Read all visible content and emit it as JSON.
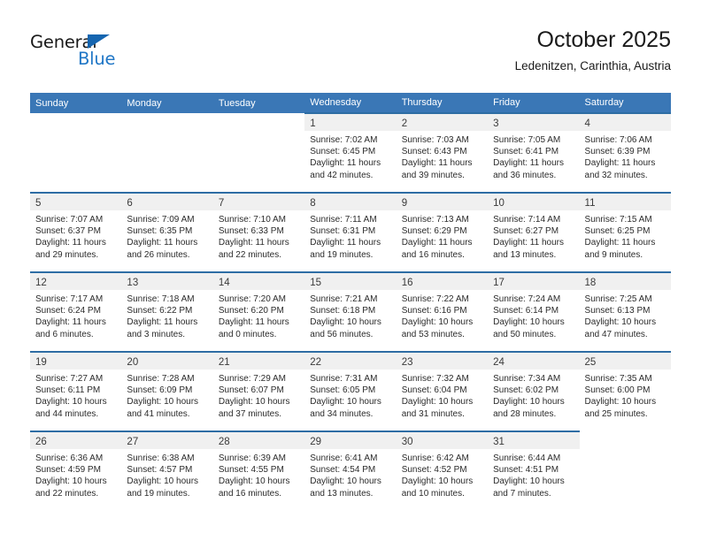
{
  "brand": {
    "name_part1": "General",
    "name_part2": "Blue"
  },
  "header": {
    "title": "October 2025",
    "subtitle": "Ledenitzen, Carinthia, Austria"
  },
  "colors": {
    "header_blue": "#3a77b6",
    "cell_border_blue": "#2e6da4",
    "daynum_band": "#f0f0f0",
    "brand_blue": "#1f76c6"
  },
  "weekdays": [
    "Sunday",
    "Monday",
    "Tuesday",
    "Wednesday",
    "Thursday",
    "Friday",
    "Saturday"
  ],
  "labels": {
    "sunrise_prefix": "Sunrise:",
    "sunset_prefix": "Sunset:",
    "daylight_prefix": "Daylight:"
  },
  "weeks": [
    [
      {
        "empty": true
      },
      {
        "empty": true
      },
      {
        "empty": true
      },
      {
        "day": "1",
        "sunrise": "Sunrise: 7:02 AM",
        "sunset": "Sunset: 6:45 PM",
        "daylight_line1": "Daylight: 11 hours",
        "daylight_line2": "and 42 minutes."
      },
      {
        "day": "2",
        "sunrise": "Sunrise: 7:03 AM",
        "sunset": "Sunset: 6:43 PM",
        "daylight_line1": "Daylight: 11 hours",
        "daylight_line2": "and 39 minutes."
      },
      {
        "day": "3",
        "sunrise": "Sunrise: 7:05 AM",
        "sunset": "Sunset: 6:41 PM",
        "daylight_line1": "Daylight: 11 hours",
        "daylight_line2": "and 36 minutes."
      },
      {
        "day": "4",
        "sunrise": "Sunrise: 7:06 AM",
        "sunset": "Sunset: 6:39 PM",
        "daylight_line1": "Daylight: 11 hours",
        "daylight_line2": "and 32 minutes."
      }
    ],
    [
      {
        "day": "5",
        "sunrise": "Sunrise: 7:07 AM",
        "sunset": "Sunset: 6:37 PM",
        "daylight_line1": "Daylight: 11 hours",
        "daylight_line2": "and 29 minutes."
      },
      {
        "day": "6",
        "sunrise": "Sunrise: 7:09 AM",
        "sunset": "Sunset: 6:35 PM",
        "daylight_line1": "Daylight: 11 hours",
        "daylight_line2": "and 26 minutes."
      },
      {
        "day": "7",
        "sunrise": "Sunrise: 7:10 AM",
        "sunset": "Sunset: 6:33 PM",
        "daylight_line1": "Daylight: 11 hours",
        "daylight_line2": "and 22 minutes."
      },
      {
        "day": "8",
        "sunrise": "Sunrise: 7:11 AM",
        "sunset": "Sunset: 6:31 PM",
        "daylight_line1": "Daylight: 11 hours",
        "daylight_line2": "and 19 minutes."
      },
      {
        "day": "9",
        "sunrise": "Sunrise: 7:13 AM",
        "sunset": "Sunset: 6:29 PM",
        "daylight_line1": "Daylight: 11 hours",
        "daylight_line2": "and 16 minutes."
      },
      {
        "day": "10",
        "sunrise": "Sunrise: 7:14 AM",
        "sunset": "Sunset: 6:27 PM",
        "daylight_line1": "Daylight: 11 hours",
        "daylight_line2": "and 13 minutes."
      },
      {
        "day": "11",
        "sunrise": "Sunrise: 7:15 AM",
        "sunset": "Sunset: 6:25 PM",
        "daylight_line1": "Daylight: 11 hours",
        "daylight_line2": "and 9 minutes."
      }
    ],
    [
      {
        "day": "12",
        "sunrise": "Sunrise: 7:17 AM",
        "sunset": "Sunset: 6:24 PM",
        "daylight_line1": "Daylight: 11 hours",
        "daylight_line2": "and 6 minutes."
      },
      {
        "day": "13",
        "sunrise": "Sunrise: 7:18 AM",
        "sunset": "Sunset: 6:22 PM",
        "daylight_line1": "Daylight: 11 hours",
        "daylight_line2": "and 3 minutes."
      },
      {
        "day": "14",
        "sunrise": "Sunrise: 7:20 AM",
        "sunset": "Sunset: 6:20 PM",
        "daylight_line1": "Daylight: 11 hours",
        "daylight_line2": "and 0 minutes."
      },
      {
        "day": "15",
        "sunrise": "Sunrise: 7:21 AM",
        "sunset": "Sunset: 6:18 PM",
        "daylight_line1": "Daylight: 10 hours",
        "daylight_line2": "and 56 minutes."
      },
      {
        "day": "16",
        "sunrise": "Sunrise: 7:22 AM",
        "sunset": "Sunset: 6:16 PM",
        "daylight_line1": "Daylight: 10 hours",
        "daylight_line2": "and 53 minutes."
      },
      {
        "day": "17",
        "sunrise": "Sunrise: 7:24 AM",
        "sunset": "Sunset: 6:14 PM",
        "daylight_line1": "Daylight: 10 hours",
        "daylight_line2": "and 50 minutes."
      },
      {
        "day": "18",
        "sunrise": "Sunrise: 7:25 AM",
        "sunset": "Sunset: 6:13 PM",
        "daylight_line1": "Daylight: 10 hours",
        "daylight_line2": "and 47 minutes."
      }
    ],
    [
      {
        "day": "19",
        "sunrise": "Sunrise: 7:27 AM",
        "sunset": "Sunset: 6:11 PM",
        "daylight_line1": "Daylight: 10 hours",
        "daylight_line2": "and 44 minutes."
      },
      {
        "day": "20",
        "sunrise": "Sunrise: 7:28 AM",
        "sunset": "Sunset: 6:09 PM",
        "daylight_line1": "Daylight: 10 hours",
        "daylight_line2": "and 41 minutes."
      },
      {
        "day": "21",
        "sunrise": "Sunrise: 7:29 AM",
        "sunset": "Sunset: 6:07 PM",
        "daylight_line1": "Daylight: 10 hours",
        "daylight_line2": "and 37 minutes."
      },
      {
        "day": "22",
        "sunrise": "Sunrise: 7:31 AM",
        "sunset": "Sunset: 6:05 PM",
        "daylight_line1": "Daylight: 10 hours",
        "daylight_line2": "and 34 minutes."
      },
      {
        "day": "23",
        "sunrise": "Sunrise: 7:32 AM",
        "sunset": "Sunset: 6:04 PM",
        "daylight_line1": "Daylight: 10 hours",
        "daylight_line2": "and 31 minutes."
      },
      {
        "day": "24",
        "sunrise": "Sunrise: 7:34 AM",
        "sunset": "Sunset: 6:02 PM",
        "daylight_line1": "Daylight: 10 hours",
        "daylight_line2": "and 28 minutes."
      },
      {
        "day": "25",
        "sunrise": "Sunrise: 7:35 AM",
        "sunset": "Sunset: 6:00 PM",
        "daylight_line1": "Daylight: 10 hours",
        "daylight_line2": "and 25 minutes."
      }
    ],
    [
      {
        "day": "26",
        "sunrise": "Sunrise: 6:36 AM",
        "sunset": "Sunset: 4:59 PM",
        "daylight_line1": "Daylight: 10 hours",
        "daylight_line2": "and 22 minutes."
      },
      {
        "day": "27",
        "sunrise": "Sunrise: 6:38 AM",
        "sunset": "Sunset: 4:57 PM",
        "daylight_line1": "Daylight: 10 hours",
        "daylight_line2": "and 19 minutes."
      },
      {
        "day": "28",
        "sunrise": "Sunrise: 6:39 AM",
        "sunset": "Sunset: 4:55 PM",
        "daylight_line1": "Daylight: 10 hours",
        "daylight_line2": "and 16 minutes."
      },
      {
        "day": "29",
        "sunrise": "Sunrise: 6:41 AM",
        "sunset": "Sunset: 4:54 PM",
        "daylight_line1": "Daylight: 10 hours",
        "daylight_line2": "and 13 minutes."
      },
      {
        "day": "30",
        "sunrise": "Sunrise: 6:42 AM",
        "sunset": "Sunset: 4:52 PM",
        "daylight_line1": "Daylight: 10 hours",
        "daylight_line2": "and 10 minutes."
      },
      {
        "day": "31",
        "sunrise": "Sunrise: 6:44 AM",
        "sunset": "Sunset: 4:51 PM",
        "daylight_line1": "Daylight: 10 hours",
        "daylight_line2": "and 7 minutes."
      },
      {
        "empty": true
      }
    ]
  ]
}
